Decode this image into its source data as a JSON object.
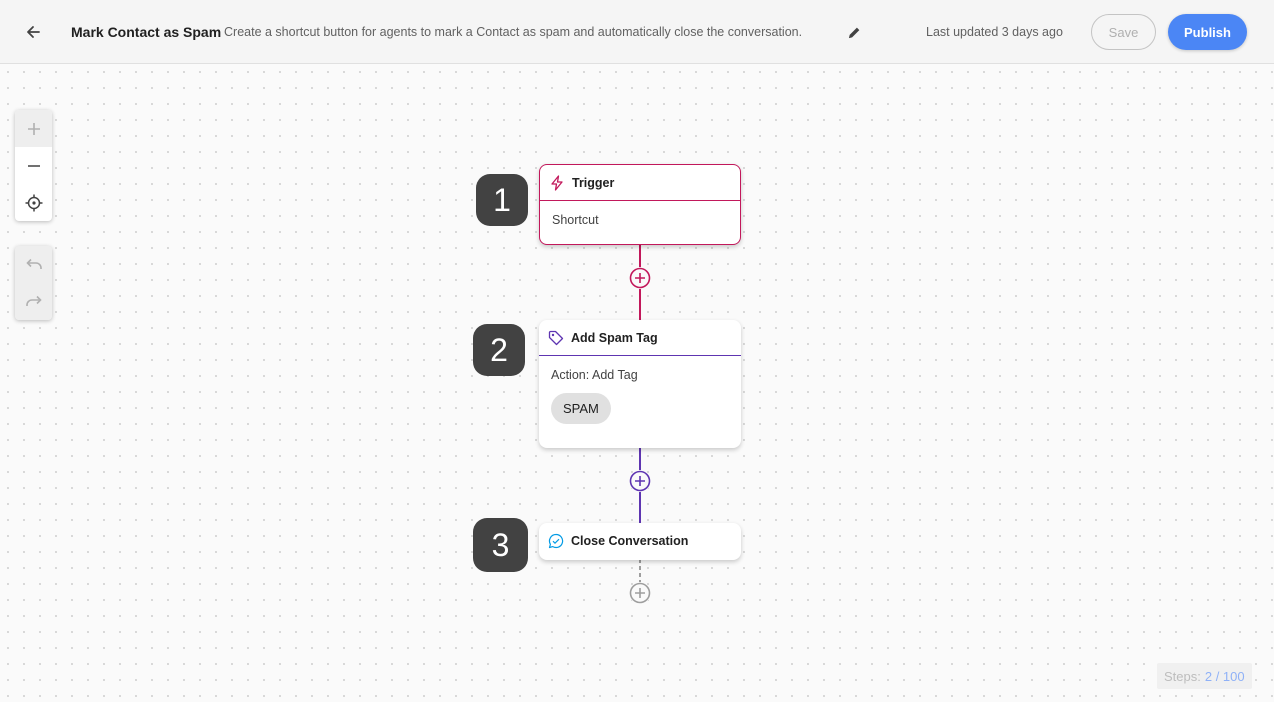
{
  "header": {
    "title": "Mark Contact as Spam",
    "description": "Create a shortcut button for agents to mark a Contact as spam and automatically close the conversation.",
    "last_updated": "Last updated 3 days ago",
    "save_label": "Save",
    "publish_label": "Publish",
    "back_icon": "arrow-left-icon",
    "edit_icon": "pencil-icon"
  },
  "controls": {
    "zoom_in_icon": "plus-icon",
    "zoom_out_icon": "minus-icon",
    "recenter_icon": "crosshair-icon",
    "undo_icon": "undo-icon",
    "redo_icon": "redo-icon"
  },
  "flow": {
    "steps": [
      {
        "number": "1",
        "title": "Trigger",
        "icon": "bolt-icon",
        "body": "Shortcut",
        "color": "#c2185b"
      },
      {
        "number": "2",
        "title": "Add Spam Tag",
        "icon": "tag-icon",
        "body": "Action: Add Tag",
        "chip": "SPAM",
        "color": "#5e35b1"
      },
      {
        "number": "3",
        "title": "Close Conversation",
        "icon": "chat-check-icon",
        "color": "#039be5"
      }
    ]
  },
  "footer": {
    "steps_label": "Steps:",
    "steps_count": "2 / 100"
  },
  "colors": {
    "accent": "#4b86f5",
    "trigger": "#c2185b",
    "action": "#5e35b1",
    "close": "#039be5"
  }
}
